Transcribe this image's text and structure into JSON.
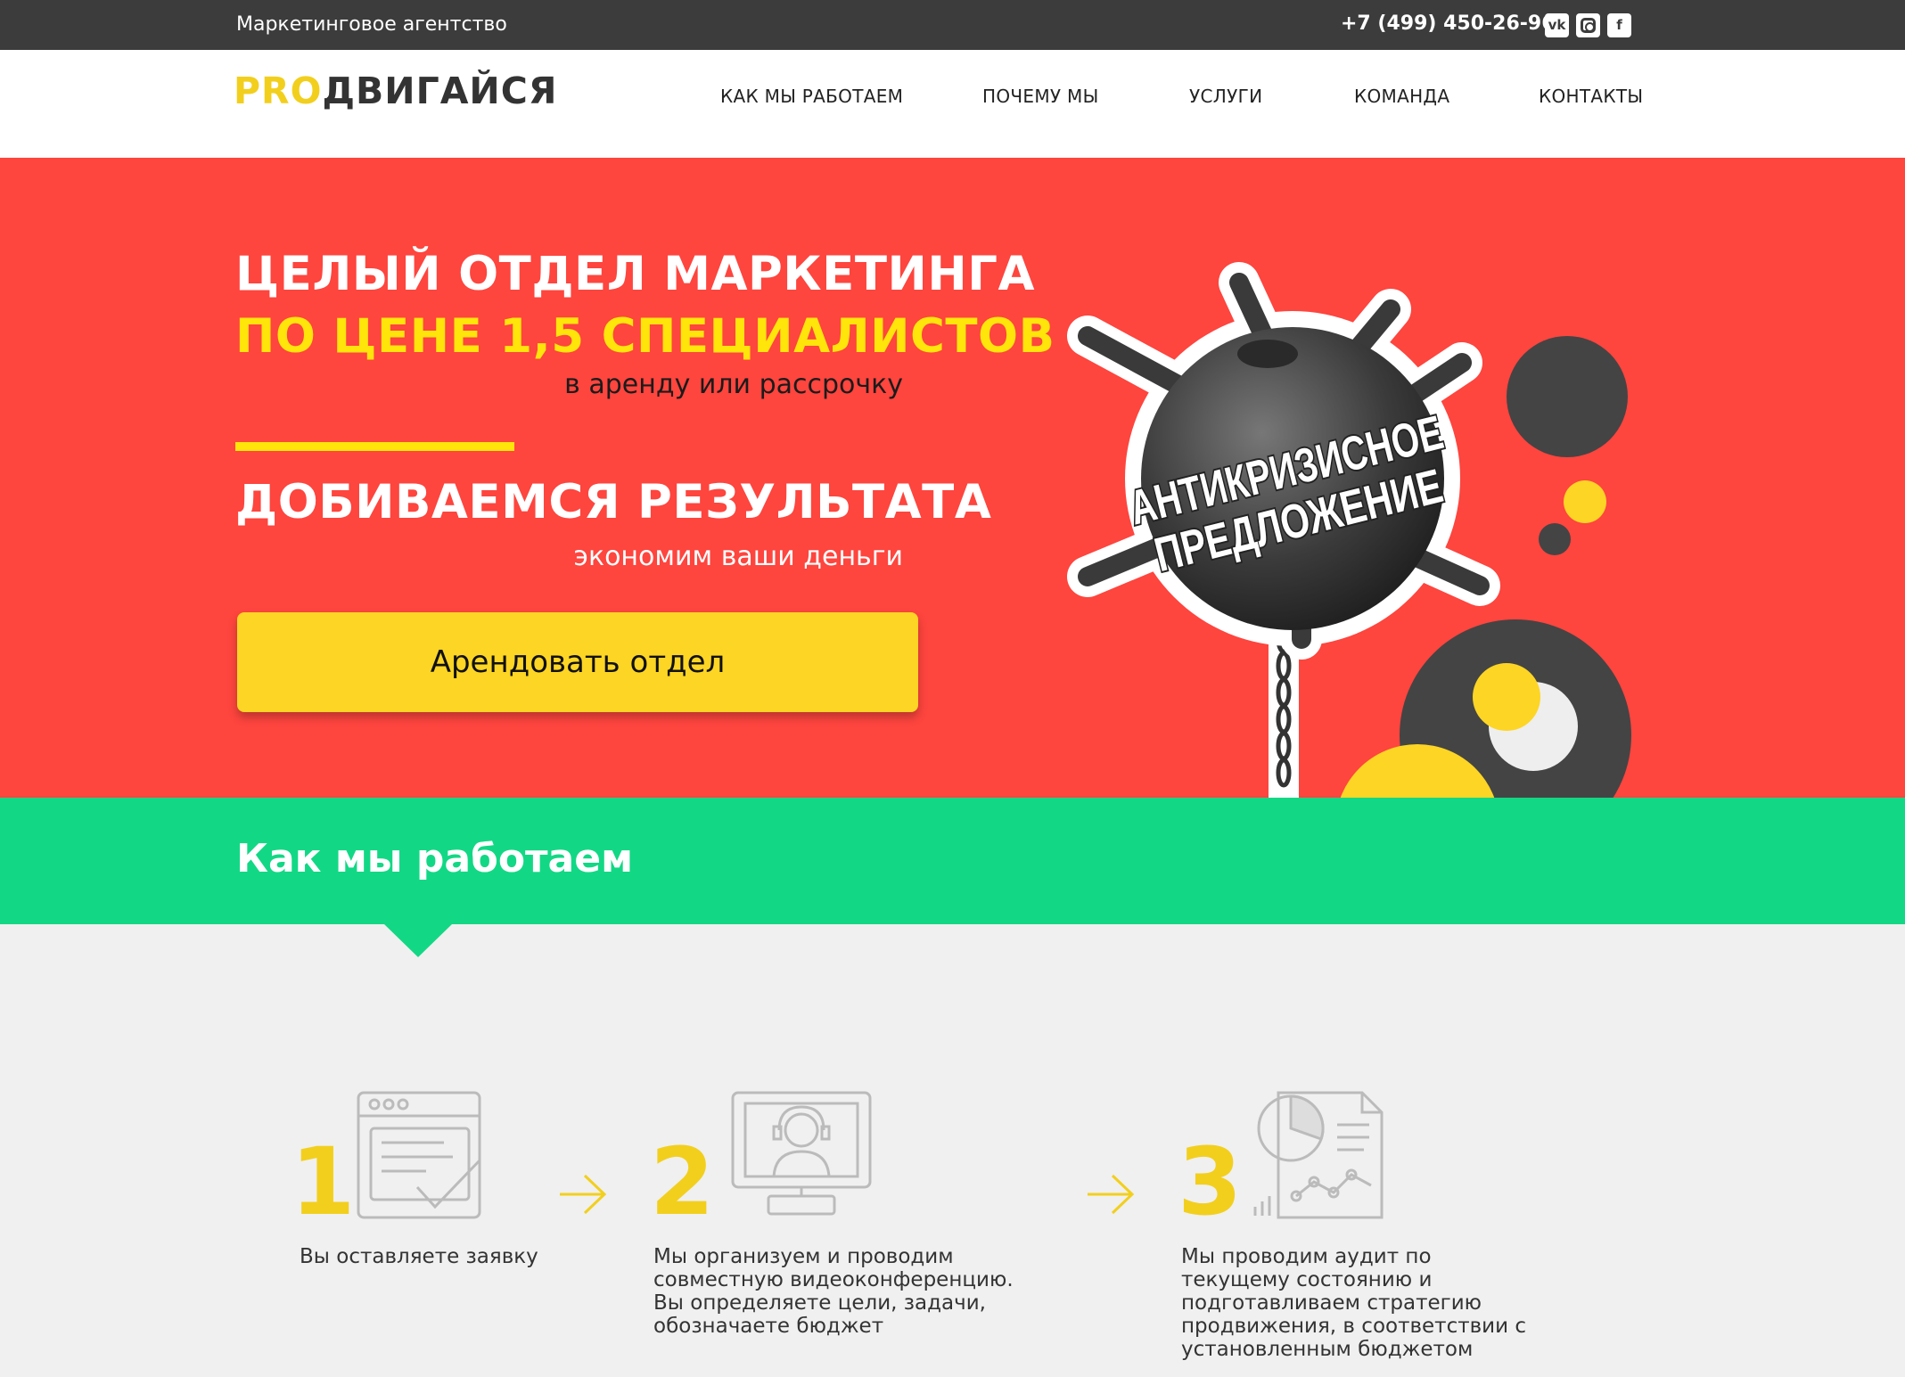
{
  "topbar": {
    "tagline": "Маркетинговое агентство",
    "phone": "+7 (499) 450-26-96",
    "social": [
      "vk-icon",
      "instagram-icon",
      "facebook-icon"
    ]
  },
  "header": {
    "logo_pro": "PRO",
    "logo_rest": "ДВИГАЙСЯ",
    "nav": [
      "КАК МЫ РАБОТАЕМ",
      "ПОЧЕМУ МЫ",
      "УСЛУГИ",
      "КОМАНДА",
      "КОНТАКТЫ"
    ]
  },
  "hero": {
    "line1": "ЦЕЛЫЙ ОТДЕЛ МАРКЕТИНГА",
    "line2": "ПО ЦЕНЕ 1,5 СПЕЦИАЛИСТОВ",
    "sub1": "в аренду или рассрочку",
    "line3": "ДОБИВАЕМСЯ РЕЗУЛЬТАТА",
    "sub2": "экономим ваши деньги",
    "cta": "Арендовать отдел",
    "badge_line1": "АНТИКРИЗИСНОЕ",
    "badge_line2": "ПРЕДЛОЖЕНИЕ"
  },
  "section": {
    "title": "Как мы работаем"
  },
  "steps": [
    {
      "num": "1",
      "text": "Вы оставляете заявку",
      "icon": "form-check-icon"
    },
    {
      "num": "2",
      "text": "Мы организуем и проводим совместную видеоконференцию. Вы определяете цели, задачи, обозначаете бюджет",
      "icon": "video-conference-icon"
    },
    {
      "num": "3",
      "text": "Мы проводим аудит по текущему состоянию и подготавливаем стратегию продвижения, в соответствии с установленным бюджетом",
      "icon": "report-chart-icon"
    }
  ],
  "colors": {
    "dark": "#3c3c3c",
    "red": "#fe453e",
    "yellow": "#fdd524",
    "green": "#12d885",
    "light": "#f0f0f0"
  }
}
